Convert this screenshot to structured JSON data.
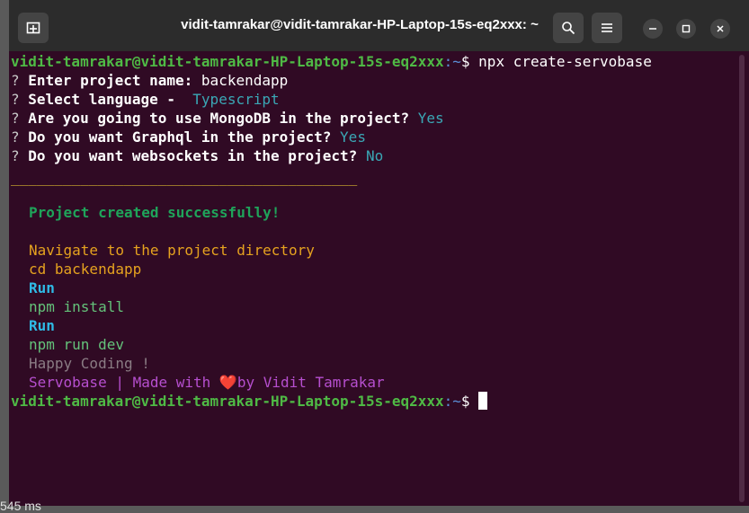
{
  "window": {
    "title": "vidit-tamrakar@vidit-tamrakar-HP-Laptop-15s-eq2xxx: ~",
    "icons": [
      "new-tab-icon",
      "search-icon",
      "menu-icon",
      "minimize-icon",
      "maximize-icon",
      "close-icon"
    ]
  },
  "terminal": {
    "prompt_user": "vidit-tamrakar@vidit-tamrakar-HP-Laptop-15s-eq2xxx",
    "prompt_path": ":~",
    "prompt_symbol": "$ ",
    "command": "npx create-servobase",
    "q_mark": "? ",
    "q1_label": "Enter project name: ",
    "q1_value": "backendapp",
    "q2_label": "Select language - ",
    "q2_value": " Typescript",
    "q3_label": "Are you going to use MongoDB in the project? ",
    "q3_value": "Yes",
    "q4_label": "Do you want Graphql in the project? ",
    "q4_value": "Yes",
    "q5_label": "Do you want websockets in the project? ",
    "q5_value": "No",
    "separator": "________________________________________",
    "success": "Project created successfully!",
    "navigate": "Navigate to the project directory",
    "cd_cmd": "cd backendapp",
    "run1": "Run",
    "install_cmd": "npm install",
    "run2": "Run",
    "dev_cmd": "npm run dev",
    "happy": "Happy Coding !",
    "made_prefix": "Servobase | Made with ",
    "heart": "❤️",
    "made_suffix": "by Vidit Tamrakar"
  },
  "background": {
    "bottom_text": "545 ms"
  },
  "colors": {
    "terminal_bg": "#300a24",
    "prompt_green": "#4fba45",
    "path_blue": "#5a8fd8",
    "answer_cyan": "#3aa7b5"
  }
}
